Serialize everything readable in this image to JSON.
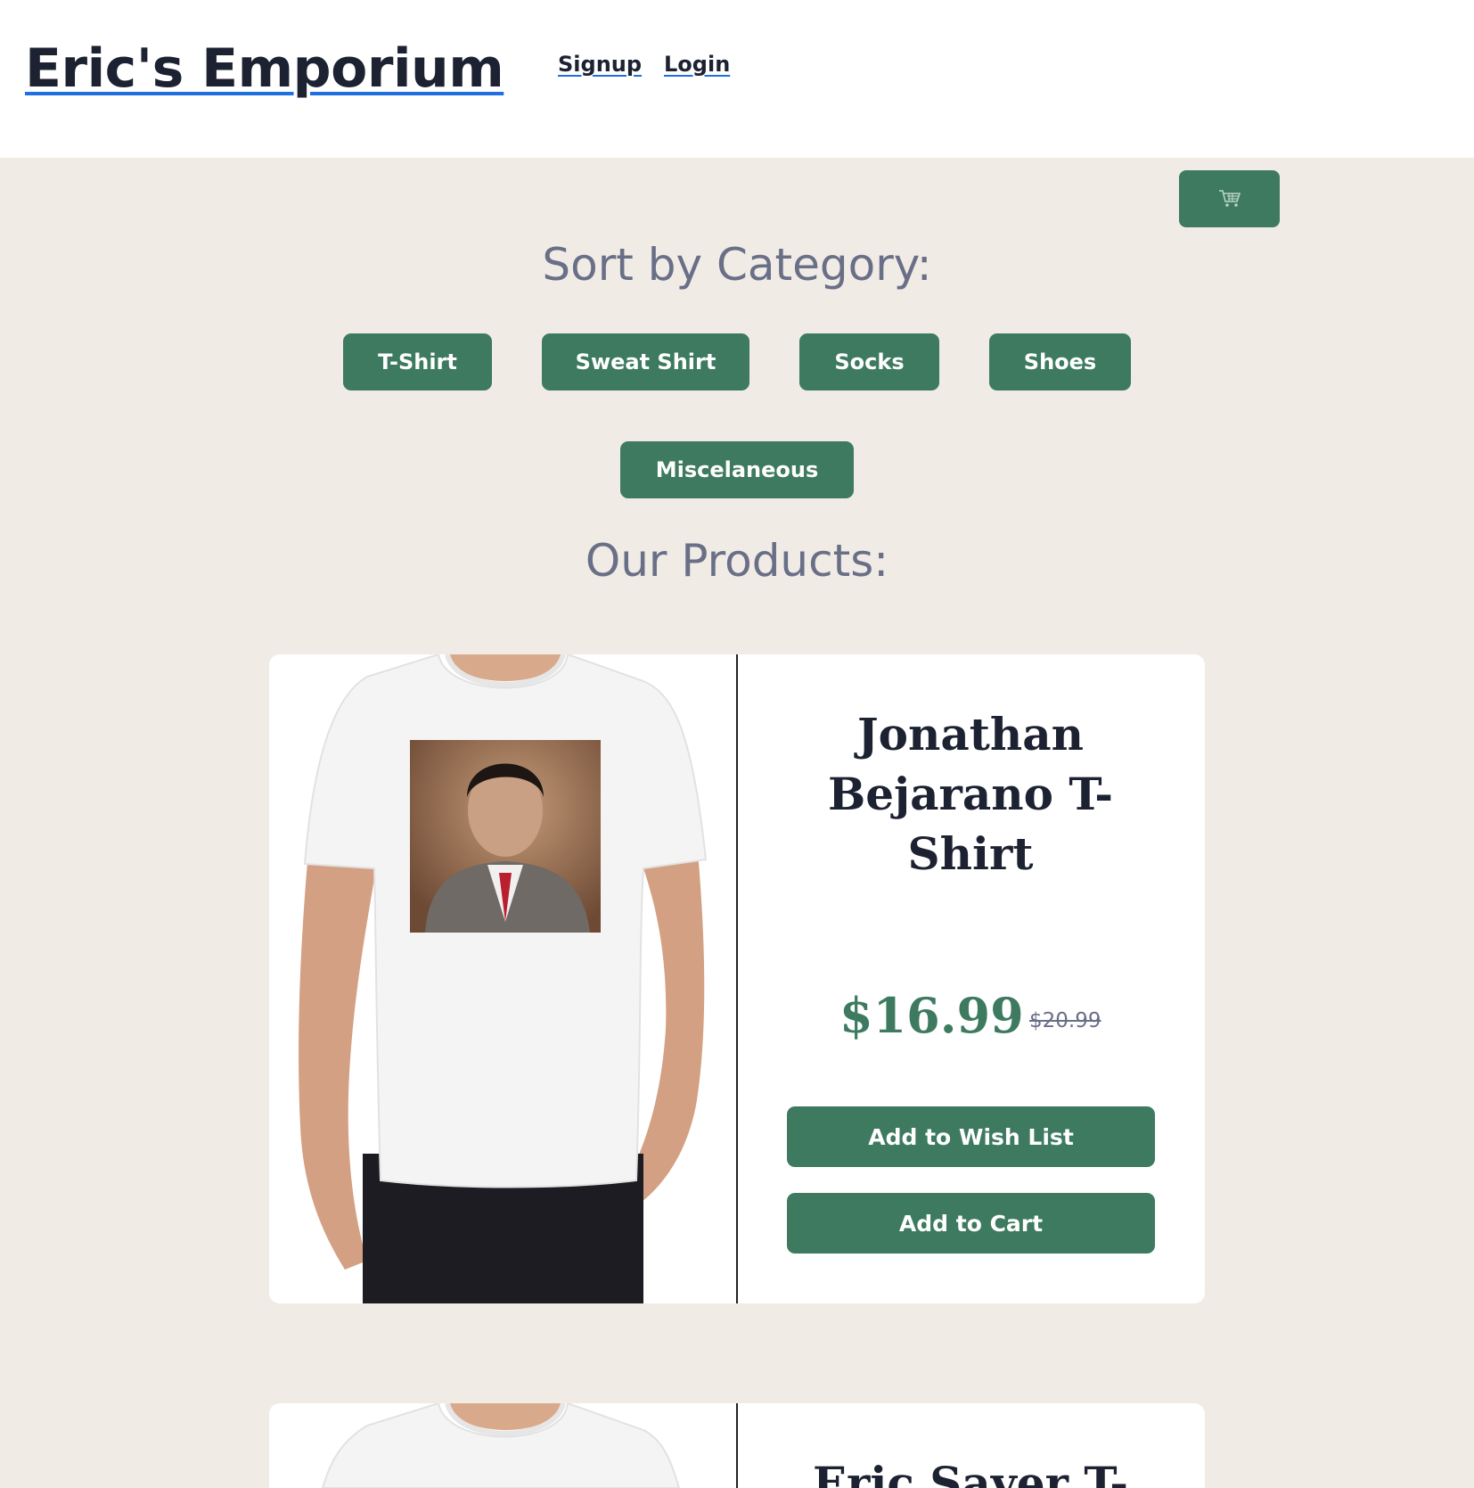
{
  "header": {
    "brand": "Eric's Emporium",
    "nav": [
      "Signup",
      "Login"
    ]
  },
  "cart": {
    "icon": "shopping-cart-icon"
  },
  "categories": {
    "title": "Sort by Category:",
    "items": [
      "T-Shirt",
      "Sweat Shirt",
      "Socks",
      "Shoes",
      "Miscelaneous"
    ]
  },
  "products": {
    "title": "Our Products:",
    "items": [
      {
        "name": "Jonathan Bejarano T-Shirt",
        "price": "$16.99",
        "old_price": "$20.99",
        "wish_label": "Add to Wish List",
        "cart_label": "Add to Cart"
      },
      {
        "name": "Eric Sayer T-"
      }
    ]
  },
  "colors": {
    "accent": "#3d7a60",
    "background": "#f0ebe4",
    "heading": "#6a6f88",
    "text": "#1d2232",
    "link_underline": "#1f6fe0"
  }
}
